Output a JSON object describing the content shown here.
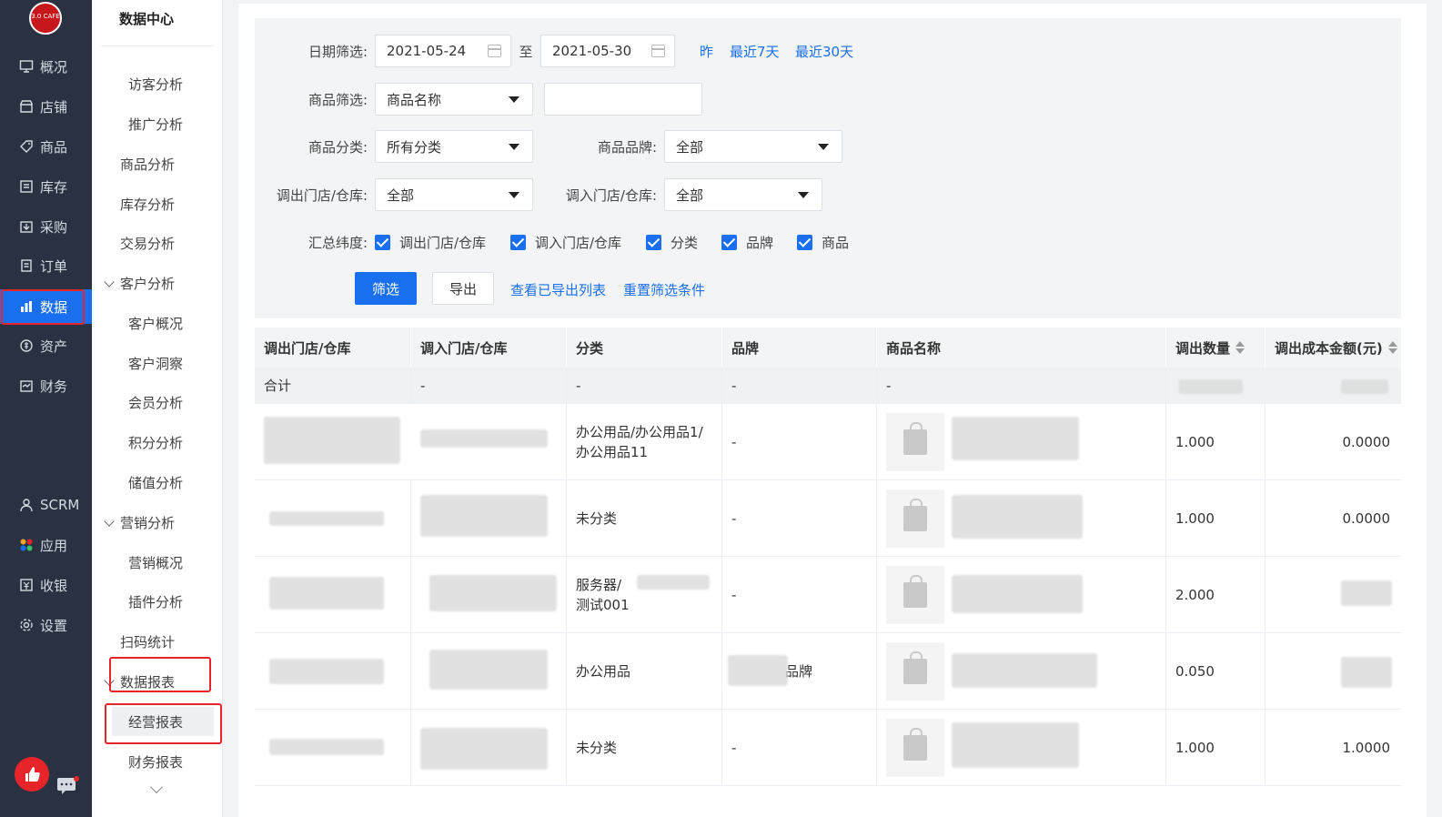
{
  "nav": {
    "logo_text": "3.0 CAFE",
    "items": [
      {
        "label": "概况",
        "icon": "monitor-icon"
      },
      {
        "label": "店铺",
        "icon": "store-icon"
      },
      {
        "label": "商品",
        "icon": "tag-icon"
      },
      {
        "label": "库存",
        "icon": "inventory-icon"
      },
      {
        "label": "采购",
        "icon": "purchase-icon"
      },
      {
        "label": "订单",
        "icon": "order-icon"
      },
      {
        "label": "数据",
        "icon": "bar-chart-icon",
        "active": true
      },
      {
        "label": "资产",
        "icon": "asset-icon"
      },
      {
        "label": "财务",
        "icon": "finance-icon"
      },
      {
        "label": "SCRM",
        "icon": "user-icon"
      },
      {
        "label": "应用",
        "icon": "apps-icon"
      },
      {
        "label": "收银",
        "icon": "cashier-icon"
      },
      {
        "label": "设置",
        "icon": "gear-icon"
      }
    ],
    "accent": "#1a6ff0",
    "highlight": "#e8242b"
  },
  "submenu": {
    "title": "数据中心",
    "items": [
      {
        "label": "访客分析",
        "level": 2
      },
      {
        "label": "推广分析",
        "level": 2
      },
      {
        "label": "商品分析",
        "level": 1
      },
      {
        "label": "库存分析",
        "level": 1
      },
      {
        "label": "交易分析",
        "level": 1
      },
      {
        "label": "客户分析",
        "level": 1,
        "group": true
      },
      {
        "label": "客户概况",
        "level": 2
      },
      {
        "label": "客户洞察",
        "level": 2
      },
      {
        "label": "会员分析",
        "level": 2
      },
      {
        "label": "积分分析",
        "level": 2
      },
      {
        "label": "储值分析",
        "level": 2
      },
      {
        "label": "营销分析",
        "level": 1,
        "group": true
      },
      {
        "label": "营销概况",
        "level": 2
      },
      {
        "label": "插件分析",
        "level": 2
      },
      {
        "label": "扫码统计",
        "level": 1
      },
      {
        "label": "数据报表",
        "level": 1,
        "group": true
      },
      {
        "label": "经营报表",
        "level": 2,
        "selected": true
      },
      {
        "label": "财务报表",
        "level": 2
      }
    ]
  },
  "filters": {
    "date_label": "日期筛选:",
    "date_start": "2021-05-24",
    "date_sep": "至",
    "date_end": "2021-05-30",
    "quick_yesterday": "昨",
    "quick_7": "最近7天",
    "quick_30": "最近30天",
    "product_label": "商品筛选:",
    "product_select": "商品名称",
    "product_input": "",
    "category_label": "商品分类:",
    "category_select": "所有分类",
    "brand_label": "商品品牌:",
    "brand_select": "全部",
    "out_store_label": "调出门店/仓库:",
    "out_store_select": "全部",
    "in_store_label": "调入门店/仓库:",
    "in_store_select": "全部",
    "dimension_label": "汇总纬度:",
    "dimensions": [
      "调出门店/仓库",
      "调入门店/仓库",
      "分类",
      "品牌",
      "商品"
    ],
    "btn_filter": "筛选",
    "btn_export": "导出",
    "link_exported": "查看已导出列表",
    "link_reset": "重置筛选条件"
  },
  "table": {
    "headers": [
      "调出门店/仓库",
      "调入门店/仓库",
      "分类",
      "品牌",
      "商品名称",
      "调出数量",
      "调出成本金额(元)"
    ],
    "total": {
      "label": "合计",
      "c2": "-",
      "c3": "-",
      "c4": "-",
      "c5": "-"
    },
    "rows": [
      {
        "category": "办公用品/办公用品1/办公用品11",
        "brand": "-",
        "qty": "1.000",
        "cost": "0.0000"
      },
      {
        "category": "未分类",
        "brand": "-",
        "qty": "1.000",
        "cost": "0.0000"
      },
      {
        "category": "服务器/",
        "category2": "测试001",
        "brand": "-",
        "qty": "2.000",
        "cost": ""
      },
      {
        "category": "办公用品",
        "brand": "品牌",
        "qty": "0.050",
        "cost": ""
      },
      {
        "category": "未分类",
        "brand": "-",
        "qty": "1.000",
        "cost": "1.0000"
      }
    ]
  }
}
